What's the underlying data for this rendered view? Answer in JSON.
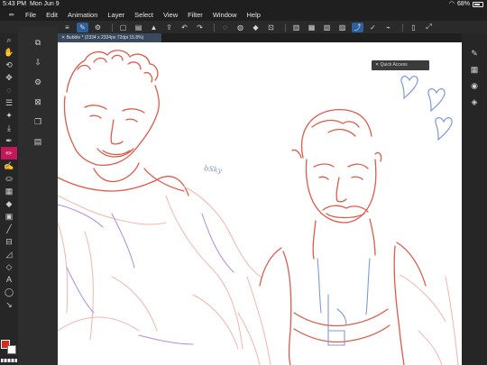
{
  "status": {
    "time": "5:43 PM",
    "date": "Mon Jun 9",
    "battery": "68%"
  },
  "menu": [
    "File",
    "Edit",
    "Animation",
    "Layer",
    "Select",
    "View",
    "Filter",
    "Window",
    "Help"
  ],
  "canvas_tab": {
    "title": "Bubble * (2334 x 2334px 72dpi 15.8%)"
  },
  "quick_access": {
    "label": "Quick Access"
  },
  "canvas_text": {
    "signature": "bSky"
  },
  "colors": {
    "main": "#d42b1e",
    "sub": "#ffffff",
    "active_tool": "#c2185b",
    "accent": "#2d5f9a",
    "sketch_red": "#e05a4a",
    "sketch_blue": "#7d9ad8",
    "sketch_purple": "#b58ae0"
  },
  "left_tools": [
    "menu-icon",
    "zoom-icon",
    "hand-icon",
    "rotate-icon",
    "move-icon",
    "lasso-icon",
    "select-icon",
    "wand-icon",
    "eyedropper-icon",
    "pen-icon",
    "pencil-icon",
    "brush-icon",
    "airbrush-icon",
    "decoration-icon",
    "eraser-icon",
    "fill-icon",
    "gradient-icon",
    "line-icon",
    "frame-icon",
    "ruler-icon",
    "text-icon",
    "balloon-icon",
    "correction-icon"
  ],
  "left_panel": [
    "layers-icon",
    "export-icon",
    "delete-icon",
    "flip-icon",
    "copy-icon"
  ],
  "right_panel": [
    "brush-size-icon",
    "material-icon",
    "navigator-icon",
    "layer-property-icon"
  ]
}
